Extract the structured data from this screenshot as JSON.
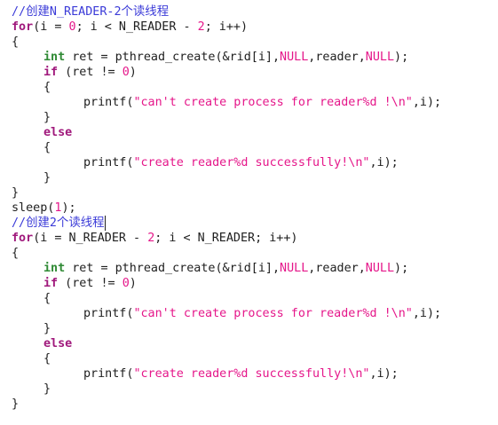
{
  "editor": {
    "lines": [
      {
        "indent": 0,
        "tokens": [
          {
            "t": "//",
            "c": "cmt"
          },
          {
            "t": "创建",
            "c": "cmt zh"
          },
          {
            "t": "N_READER-2",
            "c": "cmt"
          },
          {
            "t": "个读线程",
            "c": "cmt zh"
          }
        ]
      },
      {
        "indent": 0,
        "tokens": [
          {
            "t": "for",
            "c": "kw"
          },
          {
            "t": "(i = "
          },
          {
            "t": "0",
            "c": "num"
          },
          {
            "t": "; i < N_READER - "
          },
          {
            "t": "2",
            "c": "num"
          },
          {
            "t": "; i++)"
          }
        ]
      },
      {
        "indent": 0,
        "tokens": [
          {
            "t": "{"
          }
        ]
      },
      {
        "indent": 1,
        "tokens": [
          {
            "t": "int",
            "c": "ty"
          },
          {
            "t": " ret = pthread_create(&rid[i],"
          },
          {
            "t": "NULL",
            "c": "cst"
          },
          {
            "t": ",reader,"
          },
          {
            "t": "NULL",
            "c": "cst"
          },
          {
            "t": ");"
          }
        ]
      },
      {
        "indent": 1,
        "tokens": [
          {
            "t": "if",
            "c": "kw"
          },
          {
            "t": " (ret != "
          },
          {
            "t": "0",
            "c": "num"
          },
          {
            "t": ")"
          }
        ]
      },
      {
        "indent": 2,
        "tokens": [
          {
            "t": "{"
          }
        ]
      },
      {
        "indent": 3,
        "tokens": [
          {
            "t": "printf("
          },
          {
            "t": "\"can't create process for reader%d !\\n\"",
            "c": "str"
          },
          {
            "t": ",i);"
          }
        ]
      },
      {
        "indent": 2,
        "tokens": [
          {
            "t": "}"
          }
        ]
      },
      {
        "indent": 1,
        "tokens": [
          {
            "t": "else",
            "c": "kw"
          }
        ]
      },
      {
        "indent": 2,
        "tokens": [
          {
            "t": "{"
          }
        ]
      },
      {
        "indent": 3,
        "tokens": [
          {
            "t": "printf("
          },
          {
            "t": "\"create reader%d successfully!\\n\"",
            "c": "str"
          },
          {
            "t": ",i);"
          }
        ]
      },
      {
        "indent": 2,
        "tokens": [
          {
            "t": "}"
          }
        ]
      },
      {
        "indent": 0,
        "tokens": [
          {
            "t": "}"
          }
        ]
      },
      {
        "indent": 0,
        "tokens": [
          {
            "t": "sleep("
          },
          {
            "t": "1",
            "c": "num"
          },
          {
            "t": ");"
          }
        ]
      },
      {
        "indent": 0,
        "cursor": true,
        "tokens": [
          {
            "t": "//",
            "c": "cmt"
          },
          {
            "t": "创建",
            "c": "cmt zh"
          },
          {
            "t": "2",
            "c": "cmt"
          },
          {
            "t": "个读线程",
            "c": "cmt zh"
          }
        ]
      },
      {
        "indent": 0,
        "tokens": [
          {
            "t": "for",
            "c": "kw"
          },
          {
            "t": "(i = N_READER - "
          },
          {
            "t": "2",
            "c": "num"
          },
          {
            "t": "; i < N_READER; i++)"
          }
        ]
      },
      {
        "indent": 0,
        "tokens": [
          {
            "t": "{"
          }
        ]
      },
      {
        "indent": 1,
        "tokens": [
          {
            "t": "int",
            "c": "ty"
          },
          {
            "t": " ret = pthread_create(&rid[i],"
          },
          {
            "t": "NULL",
            "c": "cst"
          },
          {
            "t": ",reader,"
          },
          {
            "t": "NULL",
            "c": "cst"
          },
          {
            "t": ");"
          }
        ]
      },
      {
        "indent": 1,
        "tokens": [
          {
            "t": "if",
            "c": "kw"
          },
          {
            "t": " (ret != "
          },
          {
            "t": "0",
            "c": "num"
          },
          {
            "t": ")"
          }
        ]
      },
      {
        "indent": 2,
        "tokens": [
          {
            "t": "{"
          }
        ]
      },
      {
        "indent": 3,
        "tokens": [
          {
            "t": "printf("
          },
          {
            "t": "\"can't create process for reader%d !\\n\"",
            "c": "str"
          },
          {
            "t": ",i);"
          }
        ]
      },
      {
        "indent": 2,
        "tokens": [
          {
            "t": "}"
          }
        ]
      },
      {
        "indent": 1,
        "tokens": [
          {
            "t": "else",
            "c": "kw"
          }
        ]
      },
      {
        "indent": 2,
        "tokens": [
          {
            "t": "{"
          }
        ]
      },
      {
        "indent": 3,
        "tokens": [
          {
            "t": "printf("
          },
          {
            "t": "\"create reader%d successfully!\\n\"",
            "c": "str"
          },
          {
            "t": ",i);"
          }
        ]
      },
      {
        "indent": 2,
        "tokens": [
          {
            "t": "}"
          }
        ]
      },
      {
        "indent": 0,
        "tokens": [
          {
            "t": "}"
          }
        ]
      }
    ]
  },
  "colors": {
    "keyword": "#a0197c",
    "type": "#2f8a34",
    "literal": "#e5178a",
    "comment": "#3b3bd8",
    "text": "#202020",
    "background": "#ffffff"
  }
}
